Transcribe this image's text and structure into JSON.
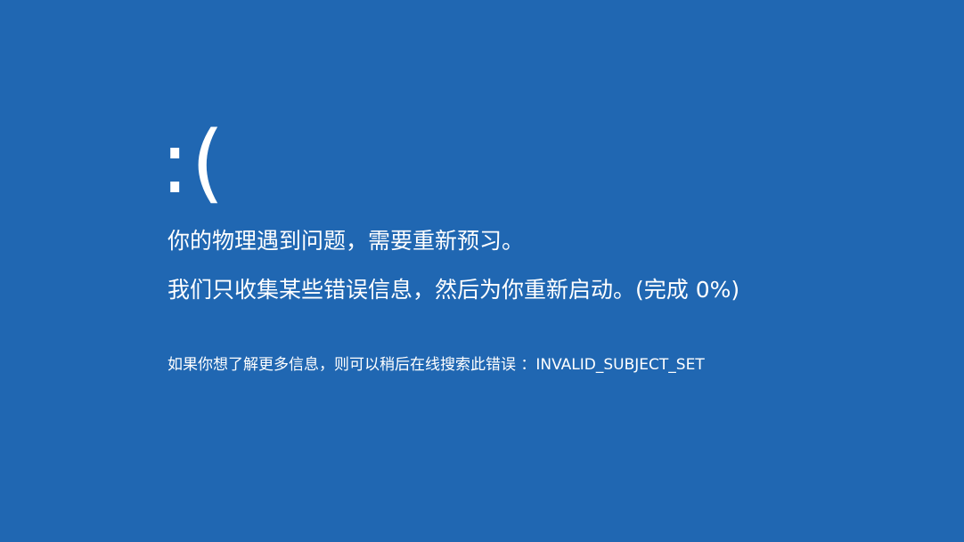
{
  "screen": {
    "background": "#2067b2",
    "text_color": "#ffffff",
    "sad_face": ":(",
    "line1": "你的物理遇到问题，需要重新预习。",
    "line2": "我们只收集某些错误信息，然后为你重新启动。(完成 0%)",
    "line3": "如果你想了解更多信息，则可以稍后在线搜索此错误 ：INVALID_SUBJECT_SET"
  }
}
